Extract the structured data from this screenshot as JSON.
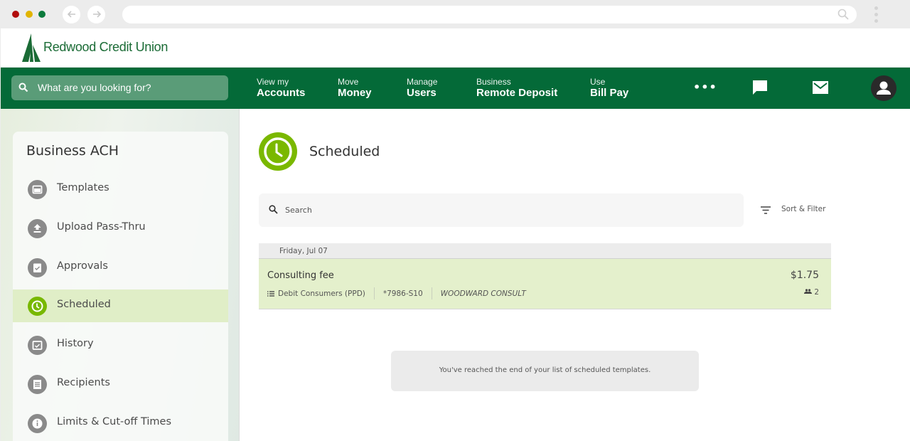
{
  "browser": {
    "back_icon": "arrow-left-icon",
    "forward_icon": "arrow-right-icon",
    "url": "",
    "colors": {
      "close": "#b10d0d",
      "minimize": "#e1b400",
      "maximize": "#0b7a3c"
    }
  },
  "brand": {
    "name": "Redwood Credit Union",
    "color": "#1a6b35"
  },
  "topnav": {
    "search_placeholder": "What are you looking for?",
    "items": [
      {
        "small": "View my",
        "large": "Accounts"
      },
      {
        "small": "Move",
        "large": "Money"
      },
      {
        "small": "Manage",
        "large": "Users"
      },
      {
        "small": "Business",
        "large": "Remote Deposit"
      },
      {
        "small": "Use",
        "large": "Bill Pay"
      }
    ],
    "more_label": "•••",
    "background": "#046a38"
  },
  "sidebar": {
    "title": "Business ACH",
    "items": [
      {
        "label": "Templates",
        "icon": "folder-icon",
        "active": false
      },
      {
        "label": "Upload Pass-Thru",
        "icon": "upload-icon",
        "active": false
      },
      {
        "label": "Approvals",
        "icon": "clipboard-check-icon",
        "active": false
      },
      {
        "label": "Scheduled",
        "icon": "clock-icon",
        "active": true
      },
      {
        "label": "History",
        "icon": "calendar-check-icon",
        "active": false
      },
      {
        "label": "Recipients",
        "icon": "list-icon",
        "active": false
      },
      {
        "label": "Limits & Cut-off Times",
        "icon": "info-icon",
        "active": false
      }
    ]
  },
  "main": {
    "title": "Scheduled",
    "search_placeholder": "Search",
    "sort_filter_label": "Sort & Filter",
    "groups": [
      {
        "date": "Friday, Jul 07",
        "items": [
          {
            "name": "Consulting fee",
            "type": "Debit Consumers (PPD)",
            "account": "*7986-S10",
            "company": "WOODWARD CONSULT",
            "amount": "$1.75",
            "recipients": "2"
          }
        ]
      }
    ],
    "end_message": "You've reached the end of your list of scheduled templates.",
    "accent": "#7ab800"
  }
}
